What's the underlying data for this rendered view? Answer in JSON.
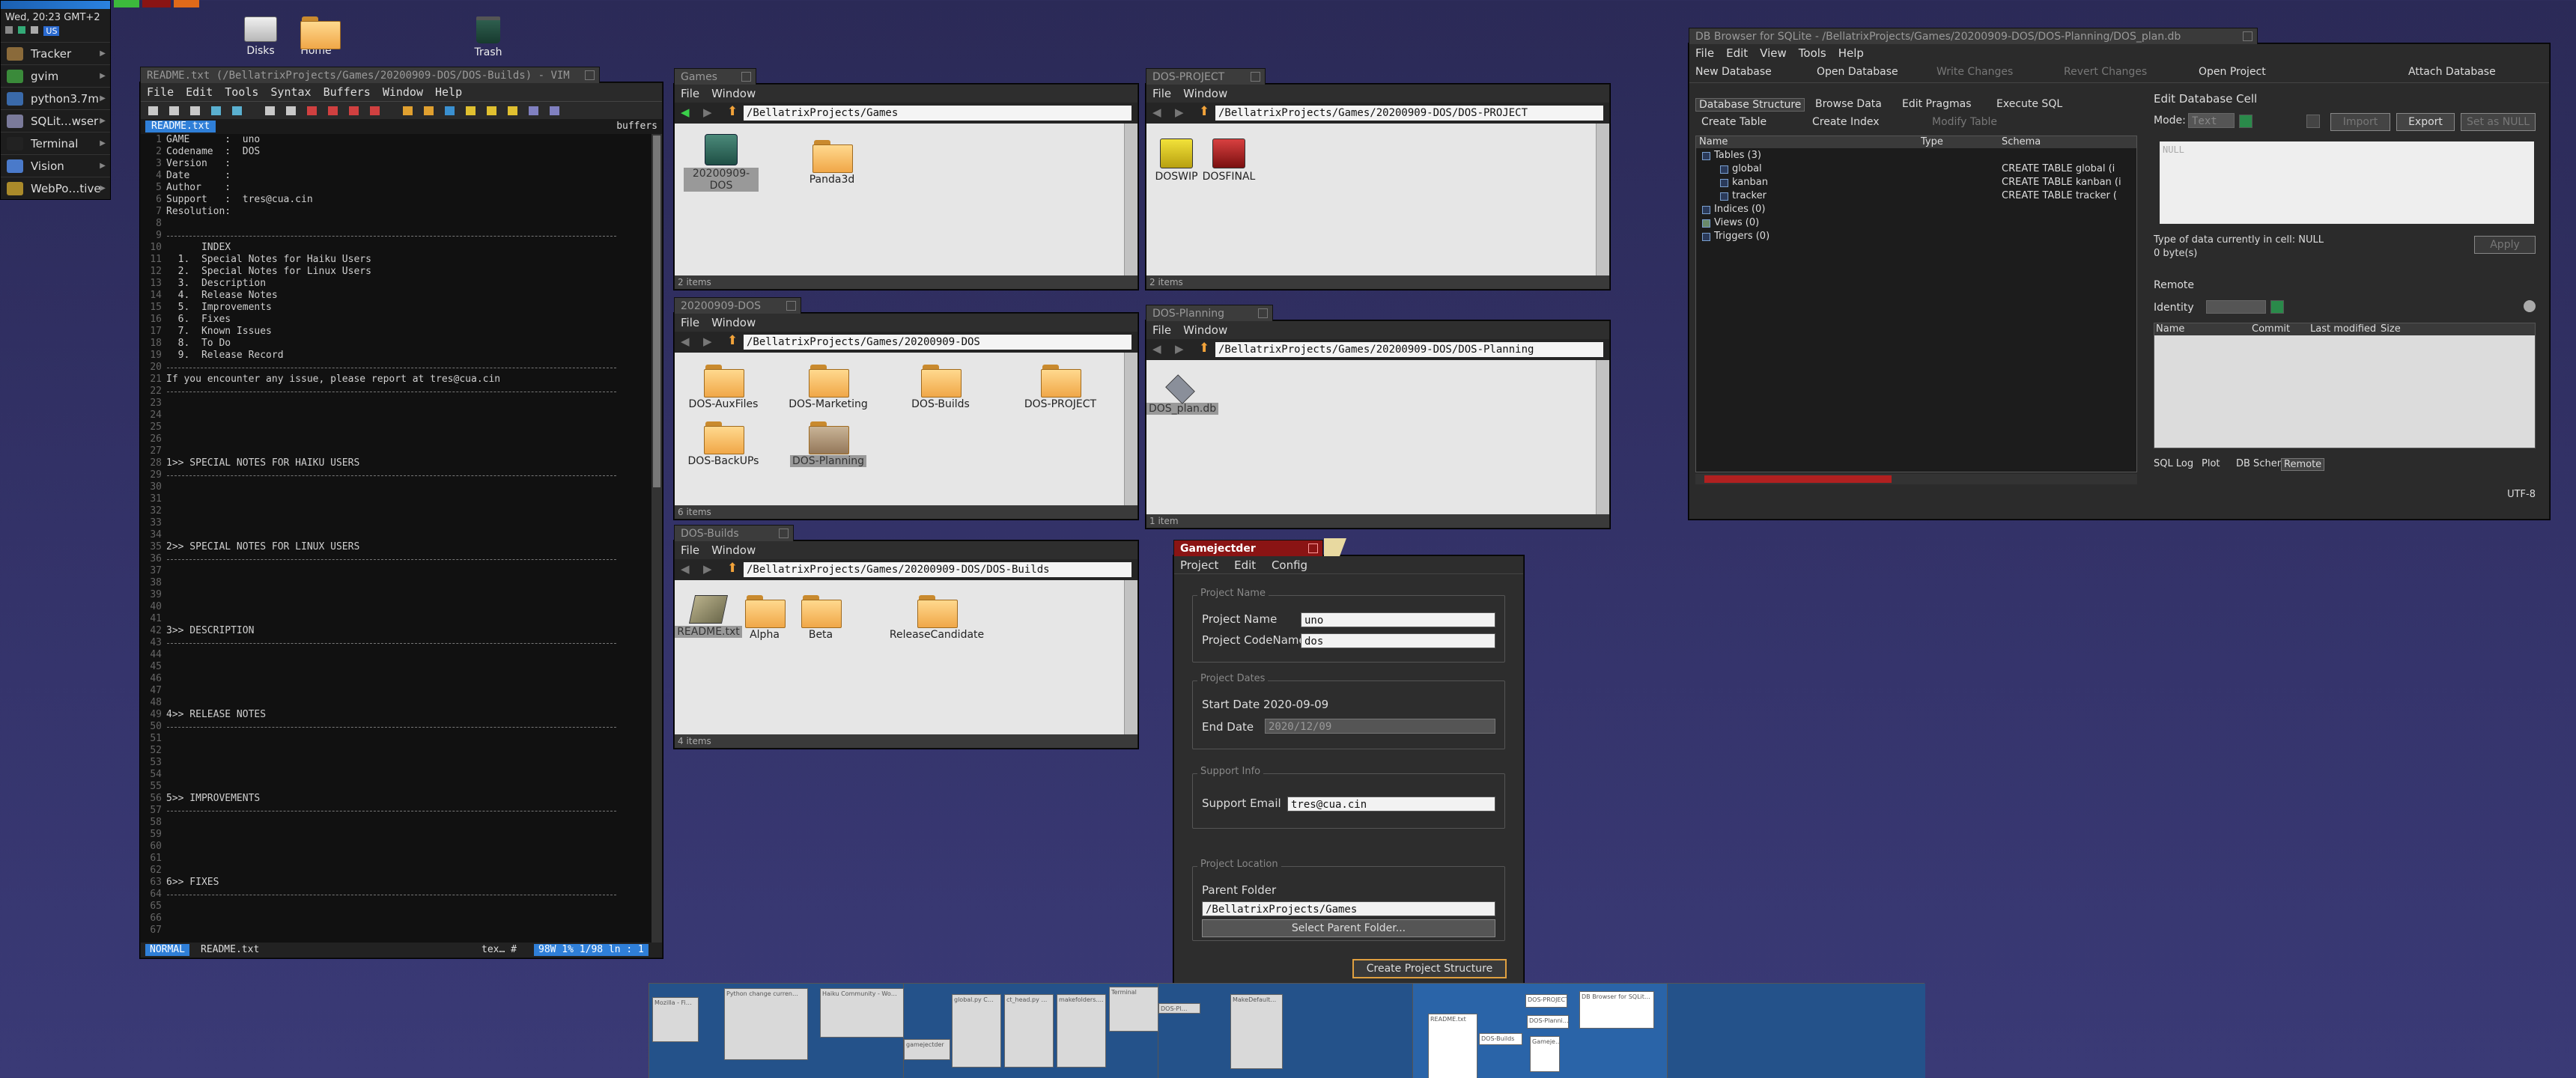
{
  "deskbar": {
    "clock": "Wed, 20:23 GMT+2",
    "keymap": "US",
    "items": [
      {
        "label": "Tracker",
        "color": "#8a6a3a"
      },
      {
        "label": "gvim",
        "color": "#3a8a3a"
      },
      {
        "label": "python3.7m",
        "color": "#3a6aaa"
      },
      {
        "label": "SQLit…wser",
        "color": "#7a7a9a"
      },
      {
        "label": "Terminal",
        "color": "#222222"
      },
      {
        "label": "Vision",
        "color": "#4a7aca"
      },
      {
        "label": "WebPo…tive",
        "color": "#aa8a2a"
      }
    ]
  },
  "desktop": {
    "icons": [
      "Disks",
      "Home",
      "Trash"
    ]
  },
  "vim": {
    "title": "README.txt (/BellatrixProjects/Games/20200909-DOS/DOS-Builds) - VIM",
    "menu": [
      "File",
      "Edit",
      "Tools",
      "Syntax",
      "Buffers",
      "Window",
      "Help"
    ],
    "tab": "README.txt",
    "tab_right": "buffers",
    "lines": [
      {
        "n": "1",
        "t": "GAME      :  uno"
      },
      {
        "n": "2",
        "t": "Codename  :  DOS"
      },
      {
        "n": "3",
        "t": "Version   :"
      },
      {
        "n": "4",
        "t": "Date      :"
      },
      {
        "n": "5",
        "t": "Author    :"
      },
      {
        "n": "6",
        "t": "Support   :  tres@cua.cin"
      },
      {
        "n": "7",
        "t": "Resolution:"
      },
      {
        "n": "8",
        "t": ""
      },
      {
        "n": "9",
        "t": "HR"
      },
      {
        "n": "10",
        "t": "      INDEX"
      },
      {
        "n": "11",
        "t": "  1.  Special Notes for Haiku Users"
      },
      {
        "n": "12",
        "t": "  2.  Special Notes for Linux Users"
      },
      {
        "n": "13",
        "t": "  3.  Description"
      },
      {
        "n": "14",
        "t": "  4.  Release Notes"
      },
      {
        "n": "15",
        "t": "  5.  Improvements"
      },
      {
        "n": "16",
        "t": "  6.  Fixes"
      },
      {
        "n": "17",
        "t": "  7.  Known Issues"
      },
      {
        "n": "18",
        "t": "  8.  To Do"
      },
      {
        "n": "19",
        "t": "  9.  Release Record"
      },
      {
        "n": "20",
        "t": "HR"
      },
      {
        "n": "21",
        "t": "If you encounter any issue, please report at tres@cua.cin"
      },
      {
        "n": "22",
        "t": "HR"
      },
      {
        "n": "23",
        "t": ""
      },
      {
        "n": "24",
        "t": ""
      },
      {
        "n": "25",
        "t": ""
      },
      {
        "n": "26",
        "t": ""
      },
      {
        "n": "27",
        "t": ""
      },
      {
        "n": "28",
        "t": "1>> SPECIAL NOTES FOR HAIKU USERS"
      },
      {
        "n": "29",
        "t": "HR"
      },
      {
        "n": "30",
        "t": ""
      },
      {
        "n": "31",
        "t": ""
      },
      {
        "n": "32",
        "t": ""
      },
      {
        "n": "33",
        "t": ""
      },
      {
        "n": "34",
        "t": ""
      },
      {
        "n": "35",
        "t": "2>> SPECIAL NOTES FOR LINUX USERS"
      },
      {
        "n": "36",
        "t": "HR"
      },
      {
        "n": "37",
        "t": ""
      },
      {
        "n": "38",
        "t": ""
      },
      {
        "n": "39",
        "t": ""
      },
      {
        "n": "40",
        "t": ""
      },
      {
        "n": "41",
        "t": ""
      },
      {
        "n": "42",
        "t": "3>> DESCRIPTION"
      },
      {
        "n": "43",
        "t": "HR"
      },
      {
        "n": "44",
        "t": ""
      },
      {
        "n": "45",
        "t": ""
      },
      {
        "n": "46",
        "t": ""
      },
      {
        "n": "47",
        "t": ""
      },
      {
        "n": "48",
        "t": ""
      },
      {
        "n": "49",
        "t": "4>> RELEASE NOTES"
      },
      {
        "n": "50",
        "t": "HR"
      },
      {
        "n": "51",
        "t": ""
      },
      {
        "n": "52",
        "t": ""
      },
      {
        "n": "53",
        "t": ""
      },
      {
        "n": "54",
        "t": ""
      },
      {
        "n": "55",
        "t": ""
      },
      {
        "n": "56",
        "t": "5>> IMPROVEMENTS"
      },
      {
        "n": "57",
        "t": "HR"
      },
      {
        "n": "58",
        "t": ""
      },
      {
        "n": "59",
        "t": ""
      },
      {
        "n": "60",
        "t": ""
      },
      {
        "n": "61",
        "t": ""
      },
      {
        "n": "62",
        "t": ""
      },
      {
        "n": "63",
        "t": "6>> FIXES"
      },
      {
        "n": "64",
        "t": "HR"
      },
      {
        "n": "65",
        "t": ""
      },
      {
        "n": "66",
        "t": ""
      },
      {
        "n": "67",
        "t": ""
      }
    ],
    "mode": "NORMAL",
    "file": "README.txt",
    "ft": "tex… #",
    "pos": "98W 1%  1/98 ln : 1"
  },
  "games": {
    "title": "Games",
    "path": "/BellatrixProjects/Games",
    "items": [
      "20200909-DOS",
      "Panda3d"
    ],
    "status": "2 items"
  },
  "dos": {
    "title": "20200909-DOS",
    "path": "/BellatrixProjects/Games/20200909-DOS",
    "items": [
      "DOS-AuxFiles",
      "DOS-Marketing",
      "DOS-Builds",
      "DOS-PROJECT",
      "DOS-BackUPs",
      "DOS-Planning"
    ],
    "status": "6 items"
  },
  "builds": {
    "title": "DOS-Builds",
    "path": "/BellatrixProjects/Games/20200909-DOS/DOS-Builds",
    "items": [
      "README.txt",
      "Alpha",
      "Beta",
      "ReleaseCandidate"
    ],
    "status": "4 items"
  },
  "project": {
    "title": "DOS-PROJECT",
    "path": "/BellatrixProjects/Games/20200909-DOS/DOS-PROJECT",
    "items": [
      "DOSWIP",
      "DOSFINAL"
    ],
    "status": "2 items"
  },
  "planning": {
    "title": "DOS-Planning",
    "path": "/BellatrixProjects/Games/20200909-DOS/DOS-Planning",
    "items": [
      "DOS_plan.db"
    ],
    "status": "1 item"
  },
  "fm_menu": {
    "file": "File",
    "window": "Window"
  },
  "gamejectder": {
    "title": "Gamejectder",
    "menu": [
      "Project",
      "Edit",
      "Config"
    ],
    "g1": "Project Name",
    "name_label": "Project Name",
    "name_value": "uno",
    "code_label": "Project CodeName",
    "code_value": "dos",
    "g2": "Project Dates",
    "start": "Start Date 2020-09-09",
    "end_label": "End Date",
    "end_value": "2020/12/09",
    "g3": "Support Info",
    "email_label": "Support Email",
    "email_value": "tres@cua.cin",
    "g4": "Project Location",
    "parent_label": "Parent Folder",
    "parent_value": "/BellatrixProjects/Games",
    "select_btn": "Select Parent Folder...",
    "create_btn": "Create Project Structure"
  },
  "sqlite": {
    "title": "DB Browser for SQLite - /BellatrixProjects/Games/20200909-DOS/DOS-Planning/DOS_plan.db",
    "menu": [
      "File",
      "Edit",
      "View",
      "Tools",
      "Help"
    ],
    "toolbar": [
      "New Database",
      "Open Database",
      "Write Changes",
      "Revert Changes",
      "Open Project",
      "Attach Database"
    ],
    "tabs": [
      "Database Structure",
      "Browse Data",
      "Edit Pragmas",
      "Execute SQL"
    ],
    "subtb": [
      "Create Table",
      "Create Index",
      "Modify Table"
    ],
    "cols": [
      "Name",
      "Type",
      "Schema"
    ],
    "tree": [
      {
        "n": "Tables (3)",
        "s": ""
      },
      {
        "n": "global",
        "s": "CREATE TABLE global (i"
      },
      {
        "n": "kanban",
        "s": "CREATE TABLE kanban (i"
      },
      {
        "n": "tracker",
        "s": "CREATE TABLE tracker ("
      },
      {
        "n": "Indices (0)",
        "s": ""
      },
      {
        "n": "Views (0)",
        "s": ""
      },
      {
        "n": "Triggers (0)",
        "s": ""
      }
    ],
    "edit_title": "Edit Database Cell",
    "mode_label": "Mode:",
    "mode_value": "Text",
    "import": "Import",
    "export": "Export",
    "setnull": "Set as NULL",
    "null_ph": "NULL",
    "type_info": "Type of data currently in cell: NULL",
    "size_info": "0 byte(s)",
    "apply": "Apply",
    "remote": "Remote",
    "identity": "Identity",
    "rcols": [
      "Name",
      "Commit",
      "Last modified",
      "Size"
    ],
    "btabs": [
      "SQL Log",
      "Plot",
      "DB Schema",
      "Remote"
    ],
    "encoding": "UTF-8"
  },
  "workspaces": {
    "thumbs": [
      "Mozilla - Fi…",
      "Python change curren…",
      "Haiku Community - Wo…",
      "gamejectder",
      "global.py C…",
      "ct_head.py …",
      "makefolders.…",
      "Terminal",
      "DOS-Pl…",
      "MakeDefault…",
      "README.txt",
      "DOS-Builds",
      "DOS-PROJECT",
      "DOS-Planni…",
      "Gameje…",
      "DB Browser for SQLit…"
    ]
  }
}
